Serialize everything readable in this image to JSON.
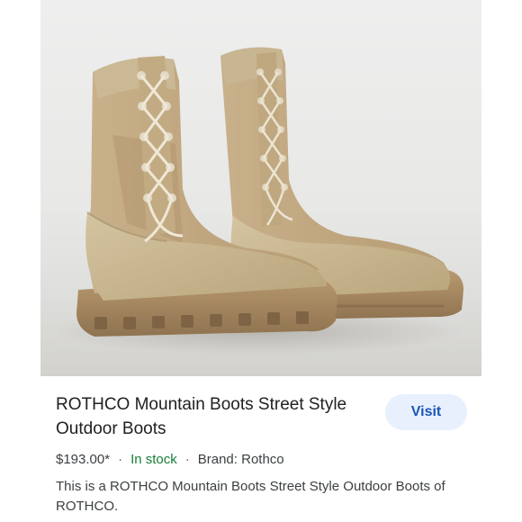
{
  "product": {
    "image_alt": "Tan suede lace-up mountain boots",
    "title": "ROTHCO Mountain Boots Street Style Outdoor Boots",
    "visit_label": "Visit",
    "price": "$193.00*",
    "separator": "·",
    "stock_status": "In stock",
    "brand": "Brand: Rothco",
    "description": "This is a ROTHCO Mountain Boots Street Style Outdoor Boots of ROTHCO."
  },
  "colors": {
    "visit_bg": "#e8f0fe",
    "visit_text": "#1a56b8",
    "stock_text": "#188038",
    "boot_suede": "#c7b48e",
    "boot_sole": "#a88a63"
  }
}
